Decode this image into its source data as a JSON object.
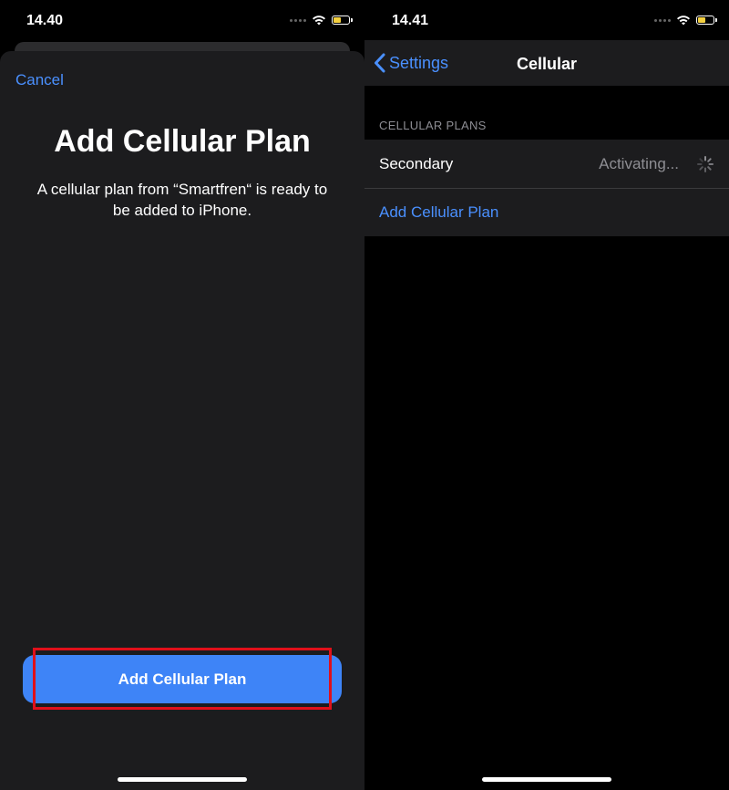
{
  "left_screen": {
    "status": {
      "time": "14.40"
    },
    "cancel_label": "Cancel",
    "title": "Add Cellular Plan",
    "description": "A cellular plan from “Smartfren“ is ready to be added to iPhone.",
    "primary_button_label": "Add Cellular Plan"
  },
  "right_screen": {
    "status": {
      "time": "14.41"
    },
    "back_label": "Settings",
    "nav_title": "Cellular",
    "section_header": "CELLULAR PLANS",
    "rows": [
      {
        "label": "Secondary",
        "value": "Activating..."
      },
      {
        "label": "Add Cellular Plan"
      }
    ]
  },
  "colors": {
    "accent": "#4a90ff",
    "button": "#3e84f7",
    "highlight": "#e0101a",
    "battery": "#f4d03f"
  },
  "icons": [
    "signal-dots-icon",
    "wifi-icon",
    "battery-icon",
    "chevron-left-icon",
    "activity-spinner-icon"
  ]
}
